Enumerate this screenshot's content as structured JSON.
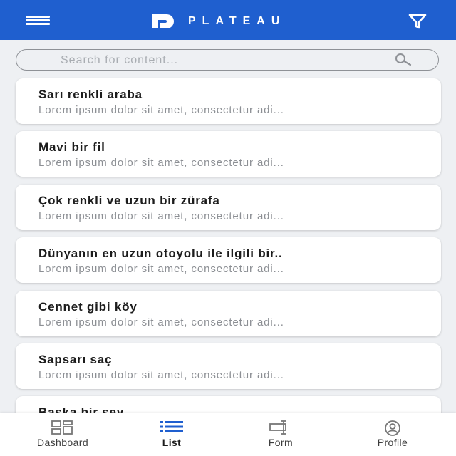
{
  "header": {
    "brand": "PLATEAU"
  },
  "search": {
    "placeholder": "Search for content..."
  },
  "items": [
    {
      "title": "Sarı renkli araba",
      "subtitle": "Lorem ipsum dolor sit amet, consectetur adi..."
    },
    {
      "title": "Mavi bir fil",
      "subtitle": "Lorem ipsum dolor sit amet, consectetur adi..."
    },
    {
      "title": "Çok renkli ve uzun bir zürafa",
      "subtitle": "Lorem ipsum dolor sit amet, consectetur adi..."
    },
    {
      "title": "Dünyanın en uzun otoyolu ile ilgili bir..",
      "subtitle": "Lorem ipsum dolor sit amet, consectetur adi..."
    },
    {
      "title": "Cennet gibi köy",
      "subtitle": "Lorem ipsum dolor sit amet, consectetur adi..."
    },
    {
      "title": "Sapsarı saç",
      "subtitle": "Lorem ipsum dolor sit amet, consectetur adi..."
    },
    {
      "title": "Başka bir şey",
      "subtitle": ""
    }
  ],
  "nav": {
    "dashboard": {
      "label": "Dashboard",
      "icon": "dashboard-icon"
    },
    "list": {
      "label": "List",
      "icon": "list-icon",
      "active": true
    },
    "form": {
      "label": "Form",
      "icon": "form-icon"
    },
    "profile": {
      "label": "Profile",
      "icon": "profile-icon"
    }
  },
  "colors": {
    "header": "#1f5fcf",
    "active_nav": "#1f5fcf",
    "background": "#eef0f3"
  }
}
